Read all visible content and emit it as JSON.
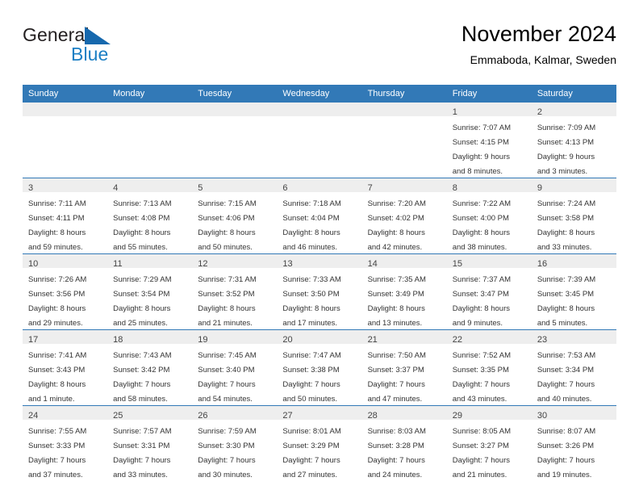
{
  "brand": {
    "line1": "General",
    "line2": "Blue",
    "logo_icon": "triangle-flag-icon",
    "accent_color": "#1b7fc4"
  },
  "header": {
    "title": "November 2024",
    "location": "Emmaboda, Kalmar, Sweden"
  },
  "theme": {
    "header_blue": "#3279b7",
    "daynum_band": "#eeeeee",
    "text": "#333333"
  },
  "weekday_headers": [
    "Sunday",
    "Monday",
    "Tuesday",
    "Wednesday",
    "Thursday",
    "Friday",
    "Saturday"
  ],
  "weeks": [
    [
      {
        "day": "",
        "info": ""
      },
      {
        "day": "",
        "info": ""
      },
      {
        "day": "",
        "info": ""
      },
      {
        "day": "",
        "info": ""
      },
      {
        "day": "",
        "info": ""
      },
      {
        "day": "1",
        "info": "Sunrise: 7:07 AM\nSunset: 4:15 PM\nDaylight: 9 hours\nand 8 minutes."
      },
      {
        "day": "2",
        "info": "Sunrise: 7:09 AM\nSunset: 4:13 PM\nDaylight: 9 hours\nand 3 minutes."
      }
    ],
    [
      {
        "day": "3",
        "info": "Sunrise: 7:11 AM\nSunset: 4:11 PM\nDaylight: 8 hours\nand 59 minutes."
      },
      {
        "day": "4",
        "info": "Sunrise: 7:13 AM\nSunset: 4:08 PM\nDaylight: 8 hours\nand 55 minutes."
      },
      {
        "day": "5",
        "info": "Sunrise: 7:15 AM\nSunset: 4:06 PM\nDaylight: 8 hours\nand 50 minutes."
      },
      {
        "day": "6",
        "info": "Sunrise: 7:18 AM\nSunset: 4:04 PM\nDaylight: 8 hours\nand 46 minutes."
      },
      {
        "day": "7",
        "info": "Sunrise: 7:20 AM\nSunset: 4:02 PM\nDaylight: 8 hours\nand 42 minutes."
      },
      {
        "day": "8",
        "info": "Sunrise: 7:22 AM\nSunset: 4:00 PM\nDaylight: 8 hours\nand 38 minutes."
      },
      {
        "day": "9",
        "info": "Sunrise: 7:24 AM\nSunset: 3:58 PM\nDaylight: 8 hours\nand 33 minutes."
      }
    ],
    [
      {
        "day": "10",
        "info": "Sunrise: 7:26 AM\nSunset: 3:56 PM\nDaylight: 8 hours\nand 29 minutes."
      },
      {
        "day": "11",
        "info": "Sunrise: 7:29 AM\nSunset: 3:54 PM\nDaylight: 8 hours\nand 25 minutes."
      },
      {
        "day": "12",
        "info": "Sunrise: 7:31 AM\nSunset: 3:52 PM\nDaylight: 8 hours\nand 21 minutes."
      },
      {
        "day": "13",
        "info": "Sunrise: 7:33 AM\nSunset: 3:50 PM\nDaylight: 8 hours\nand 17 minutes."
      },
      {
        "day": "14",
        "info": "Sunrise: 7:35 AM\nSunset: 3:49 PM\nDaylight: 8 hours\nand 13 minutes."
      },
      {
        "day": "15",
        "info": "Sunrise: 7:37 AM\nSunset: 3:47 PM\nDaylight: 8 hours\nand 9 minutes."
      },
      {
        "day": "16",
        "info": "Sunrise: 7:39 AM\nSunset: 3:45 PM\nDaylight: 8 hours\nand 5 minutes."
      }
    ],
    [
      {
        "day": "17",
        "info": "Sunrise: 7:41 AM\nSunset: 3:43 PM\nDaylight: 8 hours\nand 1 minute."
      },
      {
        "day": "18",
        "info": "Sunrise: 7:43 AM\nSunset: 3:42 PM\nDaylight: 7 hours\nand 58 minutes."
      },
      {
        "day": "19",
        "info": "Sunrise: 7:45 AM\nSunset: 3:40 PM\nDaylight: 7 hours\nand 54 minutes."
      },
      {
        "day": "20",
        "info": "Sunrise: 7:47 AM\nSunset: 3:38 PM\nDaylight: 7 hours\nand 50 minutes."
      },
      {
        "day": "21",
        "info": "Sunrise: 7:50 AM\nSunset: 3:37 PM\nDaylight: 7 hours\nand 47 minutes."
      },
      {
        "day": "22",
        "info": "Sunrise: 7:52 AM\nSunset: 3:35 PM\nDaylight: 7 hours\nand 43 minutes."
      },
      {
        "day": "23",
        "info": "Sunrise: 7:53 AM\nSunset: 3:34 PM\nDaylight: 7 hours\nand 40 minutes."
      }
    ],
    [
      {
        "day": "24",
        "info": "Sunrise: 7:55 AM\nSunset: 3:33 PM\nDaylight: 7 hours\nand 37 minutes."
      },
      {
        "day": "25",
        "info": "Sunrise: 7:57 AM\nSunset: 3:31 PM\nDaylight: 7 hours\nand 33 minutes."
      },
      {
        "day": "26",
        "info": "Sunrise: 7:59 AM\nSunset: 3:30 PM\nDaylight: 7 hours\nand 30 minutes."
      },
      {
        "day": "27",
        "info": "Sunrise: 8:01 AM\nSunset: 3:29 PM\nDaylight: 7 hours\nand 27 minutes."
      },
      {
        "day": "28",
        "info": "Sunrise: 8:03 AM\nSunset: 3:28 PM\nDaylight: 7 hours\nand 24 minutes."
      },
      {
        "day": "29",
        "info": "Sunrise: 8:05 AM\nSunset: 3:27 PM\nDaylight: 7 hours\nand 21 minutes."
      },
      {
        "day": "30",
        "info": "Sunrise: 8:07 AM\nSunset: 3:26 PM\nDaylight: 7 hours\nand 19 minutes."
      }
    ]
  ]
}
